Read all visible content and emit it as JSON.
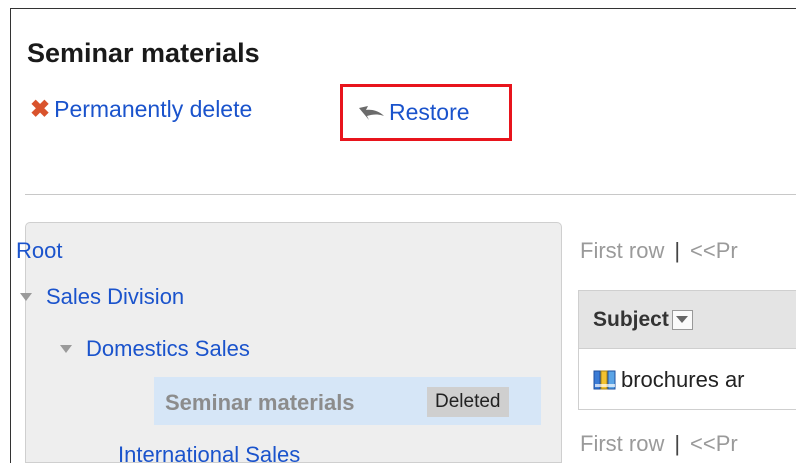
{
  "header": {
    "title": "Seminar materials"
  },
  "actions": {
    "delete_label": "Permanently delete",
    "restore_label": "Restore"
  },
  "tree": {
    "root": "Root",
    "sales_division": "Sales Division",
    "domestic_sales": "Domestics Sales",
    "selected_item": "Seminar materials",
    "selected_badge": "Deleted",
    "international_sales": "International Sales"
  },
  "pager": {
    "first_row": "First row",
    "separator": "|",
    "prev": "<<Pr"
  },
  "list": {
    "column_subject": "Subject",
    "rows": [
      {
        "subject": "brochures ar"
      }
    ]
  },
  "colors": {
    "link": "#1a53cc",
    "highlight_box": "#e8141c",
    "selected_bg": "#d6e6f7",
    "panel_bg": "#eeeeee"
  },
  "icons": {
    "delete": "x-icon",
    "restore": "restore-arrow-icon",
    "tree_toggle": "triangle-down-icon",
    "sort": "sort-dropdown-icon",
    "row": "binder-icon"
  }
}
